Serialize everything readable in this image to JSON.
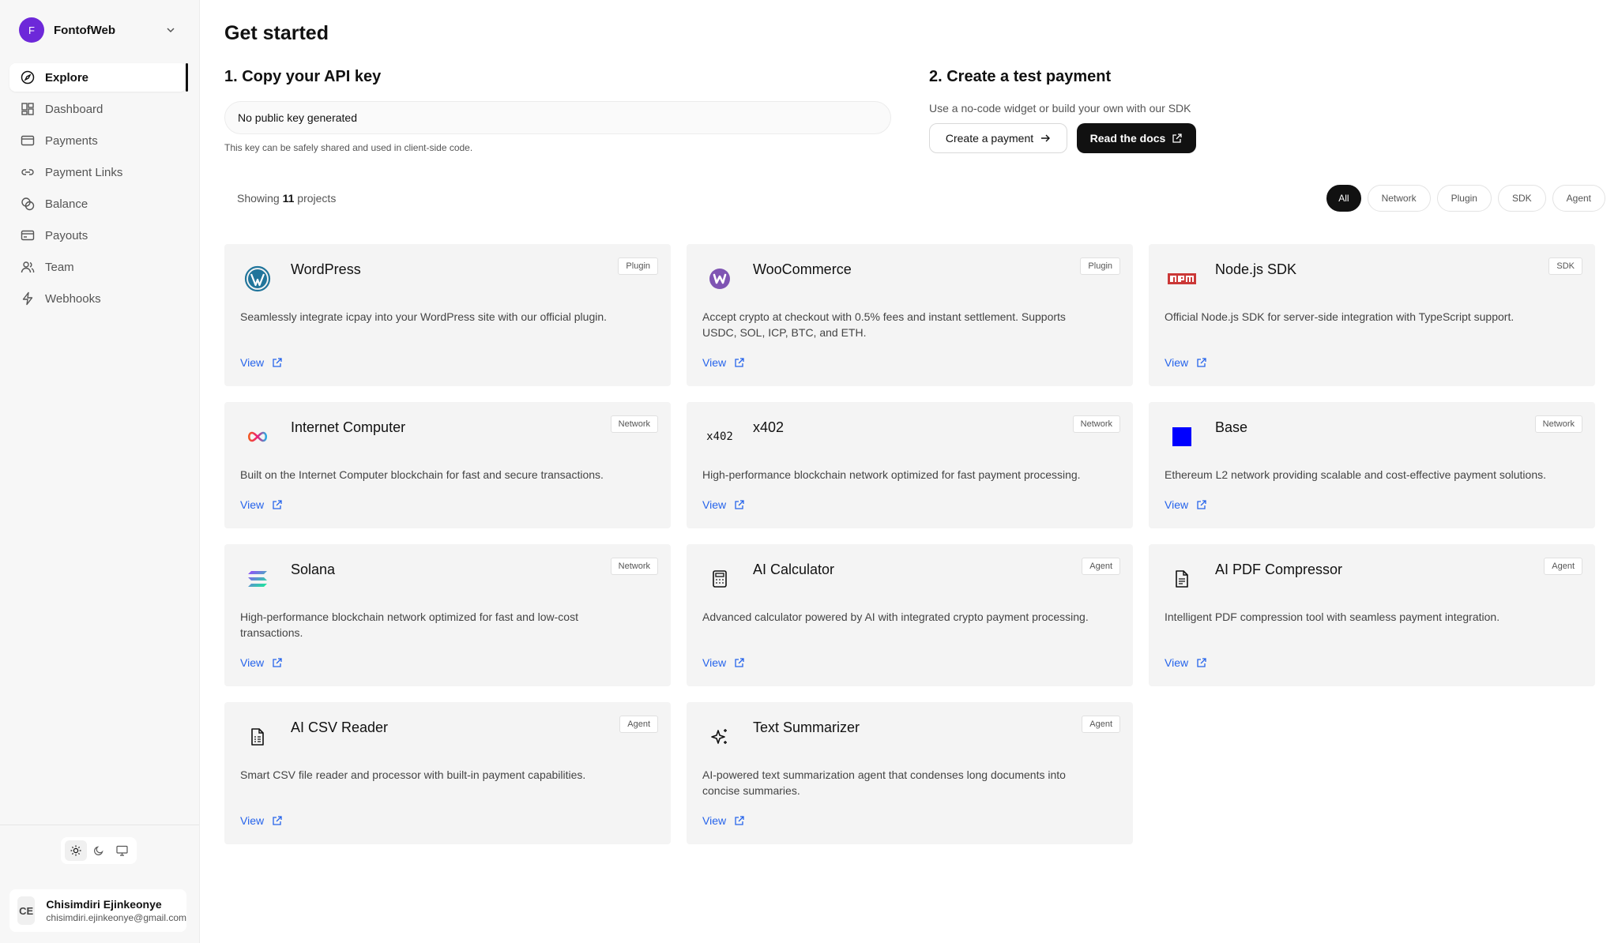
{
  "workspace": {
    "initial": "F",
    "name": "FontofWeb"
  },
  "nav": [
    {
      "label": "Explore",
      "icon": "compass-icon",
      "active": true
    },
    {
      "label": "Dashboard",
      "icon": "grid-icon"
    },
    {
      "label": "Payments",
      "icon": "credit-card-icon"
    },
    {
      "label": "Payment Links",
      "icon": "link-icon"
    },
    {
      "label": "Balance",
      "icon": "coins-icon"
    },
    {
      "label": "Payouts",
      "icon": "wallet-icon"
    },
    {
      "label": "Team",
      "icon": "users-icon"
    },
    {
      "label": "Webhooks",
      "icon": "lightning-icon"
    }
  ],
  "user": {
    "initials": "CE",
    "name": "Chisimdiri Ejinkeonye",
    "email": "chisimdiri.ejinkeonye@gmail.com"
  },
  "page": {
    "title": "Get started",
    "step1": {
      "title": "1. Copy your API key",
      "key_value": "No public key generated",
      "hint": "This key can be safely shared and used in client-side code."
    },
    "step2": {
      "title": "2. Create a test payment",
      "subtitle": "Use a no-code widget or build your own with our SDK",
      "create_label": "Create a payment",
      "docs_label": "Read the docs"
    },
    "showing": {
      "prefix": "Showing",
      "count": "11",
      "suffix": "projects"
    },
    "filters": [
      "All",
      "Network",
      "Plugin",
      "SDK",
      "Agent"
    ],
    "active_filter": "All"
  },
  "projects": [
    {
      "name": "WordPress",
      "tag": "Plugin",
      "logo": "wordpress-logo",
      "description": "Seamlessly integrate icpay into your WordPress site with our official plugin.",
      "link": "View"
    },
    {
      "name": "WooCommerce",
      "tag": "Plugin",
      "logo": "woocommerce-logo",
      "description": "Accept crypto at checkout with 0.5% fees and instant settlement. Supports USDC, SOL, ICP, BTC, and ETH.",
      "link": "View"
    },
    {
      "name": "Node.js SDK",
      "tag": "SDK",
      "logo": "npm-logo",
      "description": "Official Node.js SDK for server-side integration with TypeScript support.",
      "link": "View"
    },
    {
      "name": "Internet Computer",
      "tag": "Network",
      "logo": "infinity-logo",
      "description": "Built on the Internet Computer blockchain for fast and secure transactions.",
      "link": "View"
    },
    {
      "name": "x402",
      "tag": "Network",
      "logo": "x402-logo",
      "logo_text": "x402",
      "description": "High-performance blockchain network optimized for fast payment processing.",
      "link": "View"
    },
    {
      "name": "Base",
      "tag": "Network",
      "logo": "base-logo",
      "description": "Ethereum L2 network providing scalable and cost-effective payment solutions.",
      "link": "View"
    },
    {
      "name": "Solana",
      "tag": "Network",
      "logo": "solana-logo",
      "description": "High-performance blockchain network optimized for fast and low-cost transactions.",
      "link": "View"
    },
    {
      "name": "AI Calculator",
      "tag": "Agent",
      "logo": "calculator-icon",
      "description": "Advanced calculator powered by AI with integrated crypto payment processing.",
      "link": "View"
    },
    {
      "name": "AI PDF Compressor",
      "tag": "Agent",
      "logo": "file-icon",
      "description": "Intelligent PDF compression tool with seamless payment integration.",
      "link": "View"
    },
    {
      "name": "AI CSV Reader",
      "tag": "Agent",
      "logo": "file-spreadsheet-icon",
      "description": "Smart CSV file reader and processor with built-in payment capabilities.",
      "link": "View"
    },
    {
      "name": "Text Summarizer",
      "tag": "Agent",
      "logo": "sparkles-icon",
      "description": "AI-powered text summarization agent that condenses long documents into concise summaries.",
      "link": "View"
    }
  ],
  "colors": {
    "accent": "#6d28d9",
    "link": "#2563eb",
    "dark": "#111111",
    "card_bg": "#f4f4f4"
  }
}
